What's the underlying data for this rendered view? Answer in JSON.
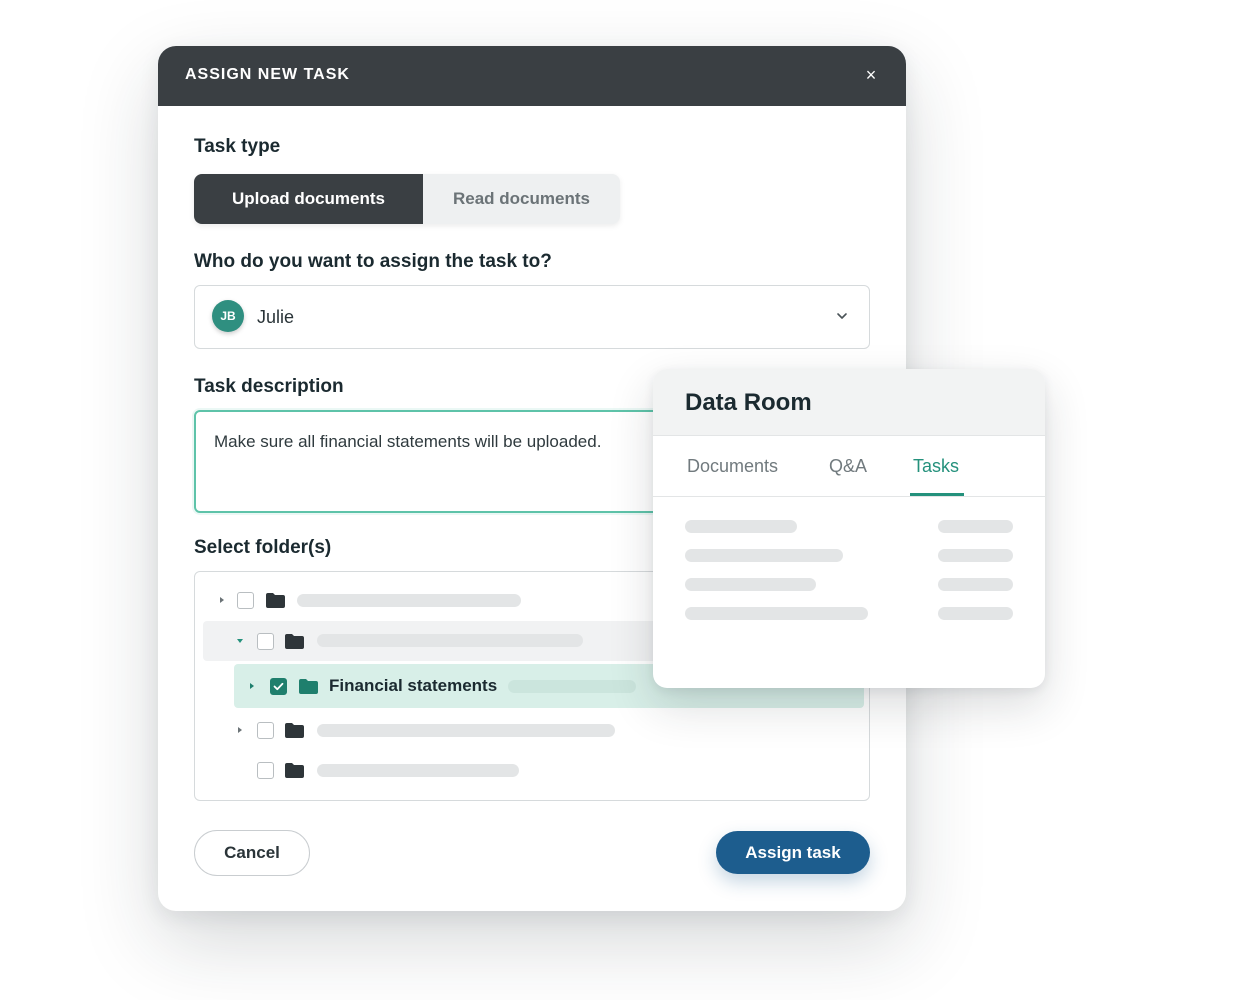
{
  "modal": {
    "title": "ASSIGN NEW TASK",
    "close_glyph": "×",
    "task_type": {
      "label": "Task type",
      "options": [
        "Upload documents",
        "Read documents"
      ],
      "selected": "Upload documents"
    },
    "assignee": {
      "label": "Who do you want to assign the task to?",
      "avatar_initials": "JB",
      "value": "Julie"
    },
    "description": {
      "label": "Task description",
      "value": "Make sure all financial statements will be uploaded."
    },
    "folders": {
      "label": "Select folder(s)",
      "selected_folder": "Financial statements"
    },
    "buttons": {
      "cancel": "Cancel",
      "assign": "Assign task"
    }
  },
  "data_room": {
    "title": "Data Room",
    "tabs": [
      "Documents",
      "Q&A",
      "Tasks"
    ],
    "active_tab": "Tasks"
  },
  "colors": {
    "header_dark": "#3a3f43",
    "accent_green": "#24917c",
    "primary_blue": "#1d5d8e"
  }
}
